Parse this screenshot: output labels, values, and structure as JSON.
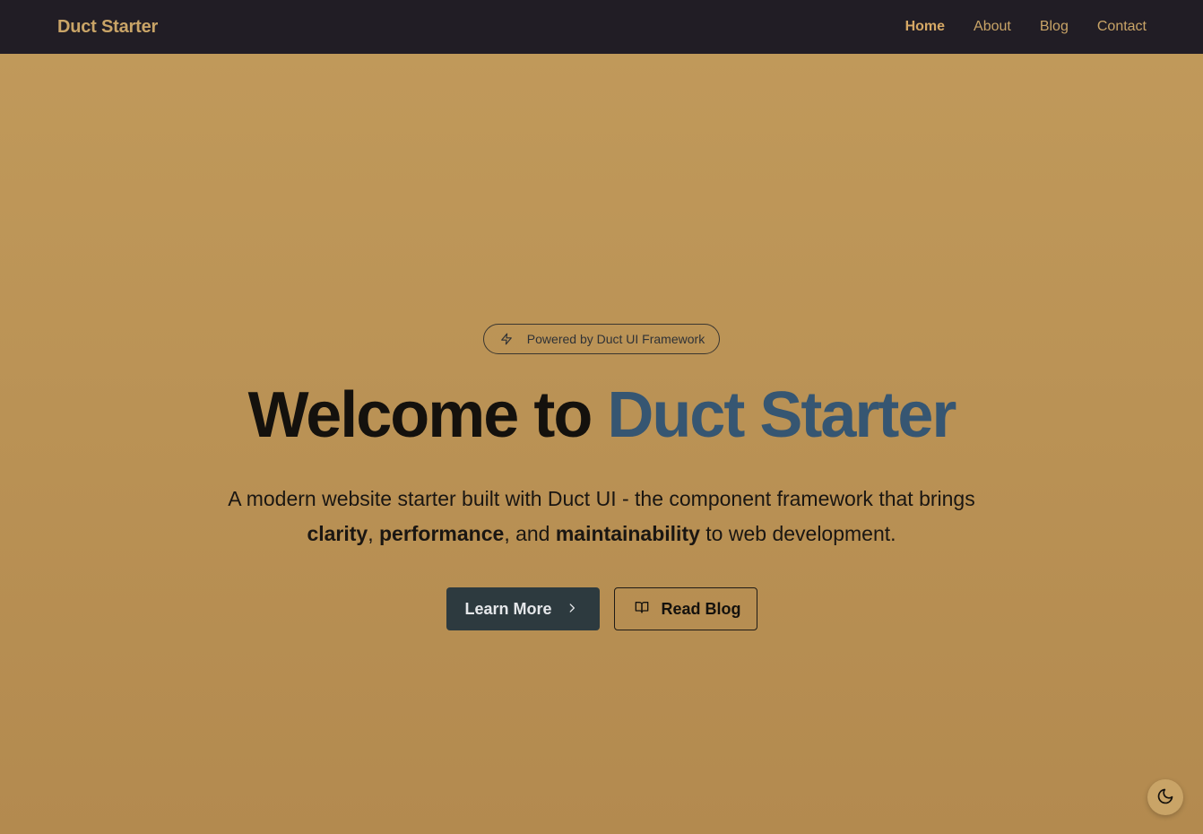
{
  "nav": {
    "brand": "Duct Starter",
    "links": [
      {
        "label": "Home",
        "active": true
      },
      {
        "label": "About",
        "active": false
      },
      {
        "label": "Blog",
        "active": false
      },
      {
        "label": "Contact",
        "active": false
      }
    ]
  },
  "hero": {
    "badge": {
      "icon": "zap-icon",
      "text": "Powered by Duct UI Framework"
    },
    "title_prefix": "Welcome to ",
    "title_accent": "Duct Starter",
    "description": {
      "line_start": "A modern website starter built with Duct UI - the component framework that brings ",
      "bold_1": "clarity",
      "sep_1": ", ",
      "bold_2": "performance",
      "sep_2": ", and ",
      "bold_3": "maintainability",
      "line_end": " to web development."
    },
    "buttons": {
      "learn_more": {
        "label": "Learn More",
        "icon": "chevron-right-icon"
      },
      "read_blog": {
        "label": "Read Blog",
        "icon": "book-open-icon"
      }
    }
  },
  "theme_toggle": {
    "icon": "moon-icon"
  },
  "colors": {
    "navbar_bg": "#211d25",
    "brand": "#c9a467",
    "accent": "#365672",
    "primary_button": "#2d3a3f",
    "background_top": "#c19a5b",
    "background_bottom": "#b38a4f"
  }
}
